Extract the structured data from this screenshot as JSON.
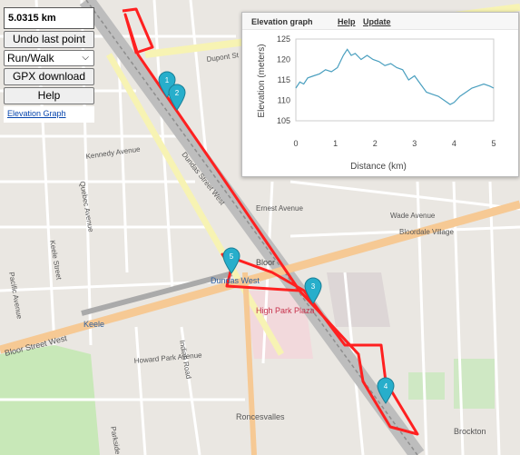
{
  "controls": {
    "distance": "5.0315 km",
    "undo_label": "Undo last point",
    "activity_value": "Run/Walk",
    "gpx_label": "GPX download",
    "help_label": "Help",
    "elevation_link": "Elevation Graph"
  },
  "elevation_panel": {
    "title": "Elevation graph",
    "help_link": "Help",
    "update_link": "Update",
    "ylabel": "Elevation (meters)",
    "xlabel": "Distance (km)"
  },
  "chart_data": {
    "type": "line",
    "ylabel": "Elevation (meters)",
    "xlabel": "Distance (km)",
    "xlim": [
      0,
      5
    ],
    "ylim": [
      105,
      125
    ],
    "xticks": [
      "0",
      "1",
      "2",
      "3",
      "4",
      "5"
    ],
    "yticks": [
      "105",
      "110",
      "115",
      "120",
      "125"
    ],
    "x": [
      0,
      0.1,
      0.2,
      0.3,
      0.45,
      0.6,
      0.75,
      0.9,
      1.05,
      1.2,
      1.3,
      1.4,
      1.5,
      1.65,
      1.8,
      1.95,
      2.1,
      2.25,
      2.4,
      2.55,
      2.7,
      2.85,
      3.0,
      3.15,
      3.3,
      3.45,
      3.6,
      3.75,
      3.9,
      4.0,
      4.15,
      4.3,
      4.45,
      4.6,
      4.75,
      4.9,
      5.0
    ],
    "y": [
      113,
      114.5,
      114,
      115.5,
      116,
      116.5,
      117.5,
      117,
      118,
      121,
      122.5,
      121,
      121.5,
      120,
      121,
      120,
      119.5,
      118.5,
      119,
      118,
      117.5,
      115,
      116,
      114,
      112,
      111.5,
      111,
      110,
      109,
      109.5,
      111,
      112,
      113,
      113.5,
      114,
      113.5,
      113
    ],
    "line_color": "#4a9fbf",
    "grid": false
  },
  "map": {
    "street_labels": [
      "Dupont St",
      "Dundas Street West",
      "Bloor",
      "Bloor Street West",
      "Dundas West",
      "High Park Plaza",
      "Keele",
      "Roncesvalles",
      "Brockton",
      "Bloordale Village",
      "Wade Avenue",
      "Ernest Avenue",
      "Indian Road",
      "Kennedy Avenue",
      "Keele Street",
      "Parkside",
      "Howard Park Avenue",
      "Pacific Avenue",
      "Quebec Avenue"
    ],
    "markers": [
      "1",
      "2",
      "3",
      "4",
      "5"
    ],
    "route_color": "#ff2020"
  }
}
